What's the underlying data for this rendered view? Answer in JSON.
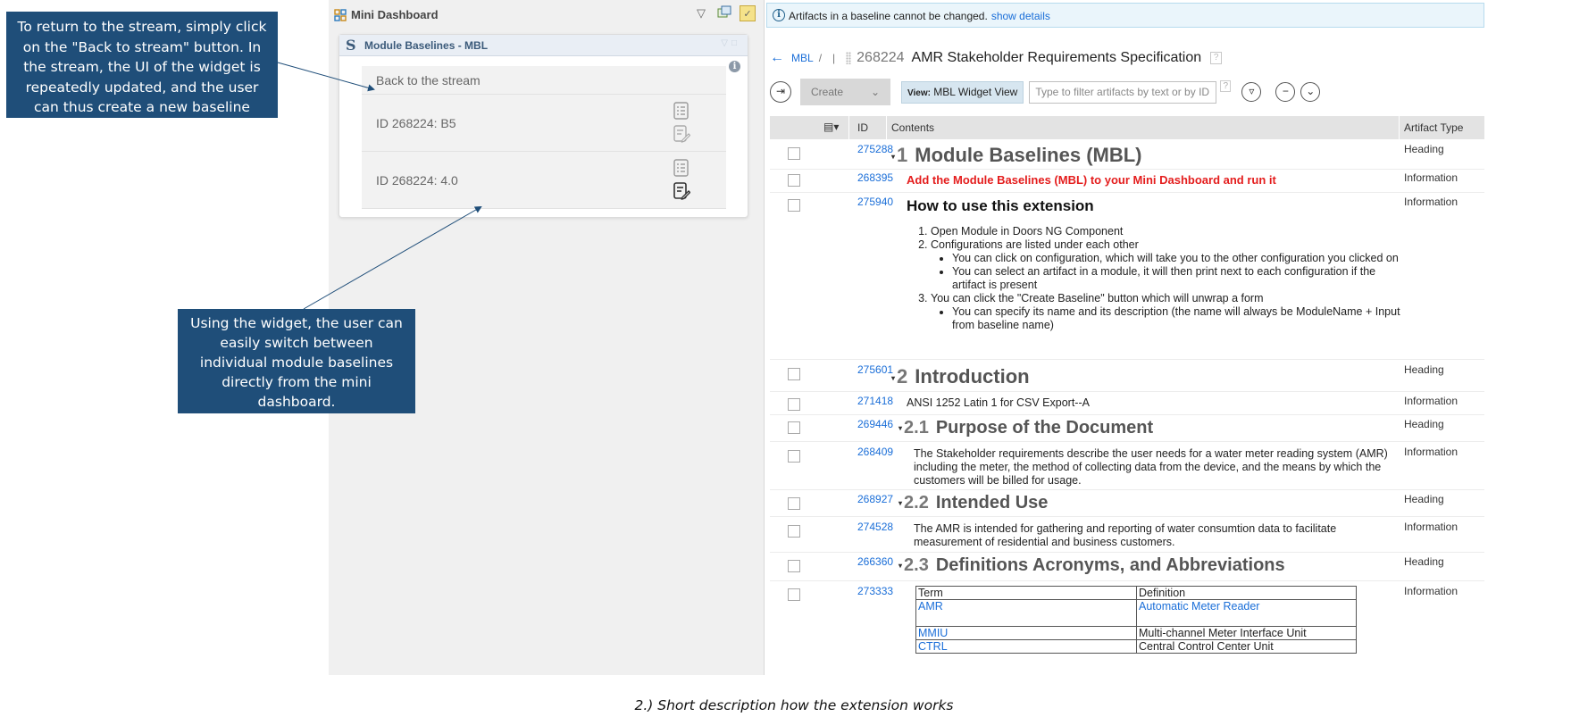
{
  "callouts": {
    "return_to_stream": "To return to the stream, simply click on the \"Back to stream\" button. In the stream, the UI of the widget is repeatedly updated, and the user can thus create a new baseline",
    "switch_baselines": "Using the widget, the user can easily switch between individual module baselines directly from the mini dashboard."
  },
  "mini_dashboard": {
    "title": "Mini Dashboard",
    "widget": {
      "title": "Module Baselines - MBL",
      "back_label": "Back to the stream",
      "baselines": [
        "ID 268224: B5",
        "ID 268224: 4.0"
      ]
    }
  },
  "banner": {
    "text": "Artifacts in a baseline cannot be changed.",
    "link": "show details"
  },
  "breadcrumb": {
    "project": "MBL",
    "separator": "/",
    "module_id": "268224",
    "module_name": "AMR Stakeholder Requirements Specification",
    "help": "?"
  },
  "toolbar": {
    "create_label": "Create",
    "view_prefix": "View:",
    "view_name": "MBL Widget View",
    "filter_placeholder": "Type to filter artifacts by text or by ID",
    "help": "?"
  },
  "table": {
    "headers": {
      "id": "ID",
      "contents": "Contents",
      "type": "Artifact Type"
    },
    "rows": [
      {
        "id": "275288",
        "num": "1",
        "text": "Module Baselines (MBL)",
        "type": "Heading"
      },
      {
        "id": "268395",
        "text": "Add the Module Baselines (MBL) to your Mini Dashboard and run it",
        "type": "Information"
      },
      {
        "id": "275940",
        "title": "How to use this extension",
        "type": "Information",
        "steps": [
          "Open Module in Doors NG Component",
          "Configurations are listed under each other",
          "You can click on configuration, which will take you to the other configuration you clicked on",
          "You can select an artifact in a module, it will then print next to each configuration if the artifact is present",
          "You can click the \"Create Baseline\" button  which will unwrap a form",
          "You can specify its name and its description (the name will always be ModuleName + Input from baseline name)"
        ]
      },
      {
        "id": "275601",
        "num": "2",
        "text": "Introduction",
        "type": "Heading"
      },
      {
        "id": "271418",
        "text": "ANSI 1252 Latin 1 for CSV Export--A",
        "type": "Information"
      },
      {
        "id": "269446",
        "num": "2.1",
        "text": "Purpose of the Document",
        "type": "Heading"
      },
      {
        "id": "268409",
        "text": "The Stakeholder requirements describe the user needs for a water meter reading system (AMR) including the meter, the method of collecting data from the device, and the means by which the customers will be billed for usage.",
        "type": "Information"
      },
      {
        "id": "268927",
        "num": "2.2",
        "text": "Intended Use",
        "type": "Heading"
      },
      {
        "id": "274528",
        "text": "The AMR is intended for gathering and reporting of water consumtion data to facilitate measurement of residential and business customers.",
        "type": "Information"
      },
      {
        "id": "266360",
        "num": "2.3",
        "text": "Definitions Acronyms, and Abbreviations",
        "type": "Heading"
      },
      {
        "id": "273333",
        "type": "Information",
        "defs": {
          "head": [
            "Term",
            "Definition"
          ],
          "rows": [
            [
              "AMR",
              "Automatic Meter Reader"
            ],
            [
              "MMIU",
              "Multi-channel Meter Interface Unit"
            ],
            [
              "CTRL",
              "Central Control Center Unit"
            ]
          ]
        }
      }
    ]
  },
  "caption": "2.) Short description how the extension works"
}
